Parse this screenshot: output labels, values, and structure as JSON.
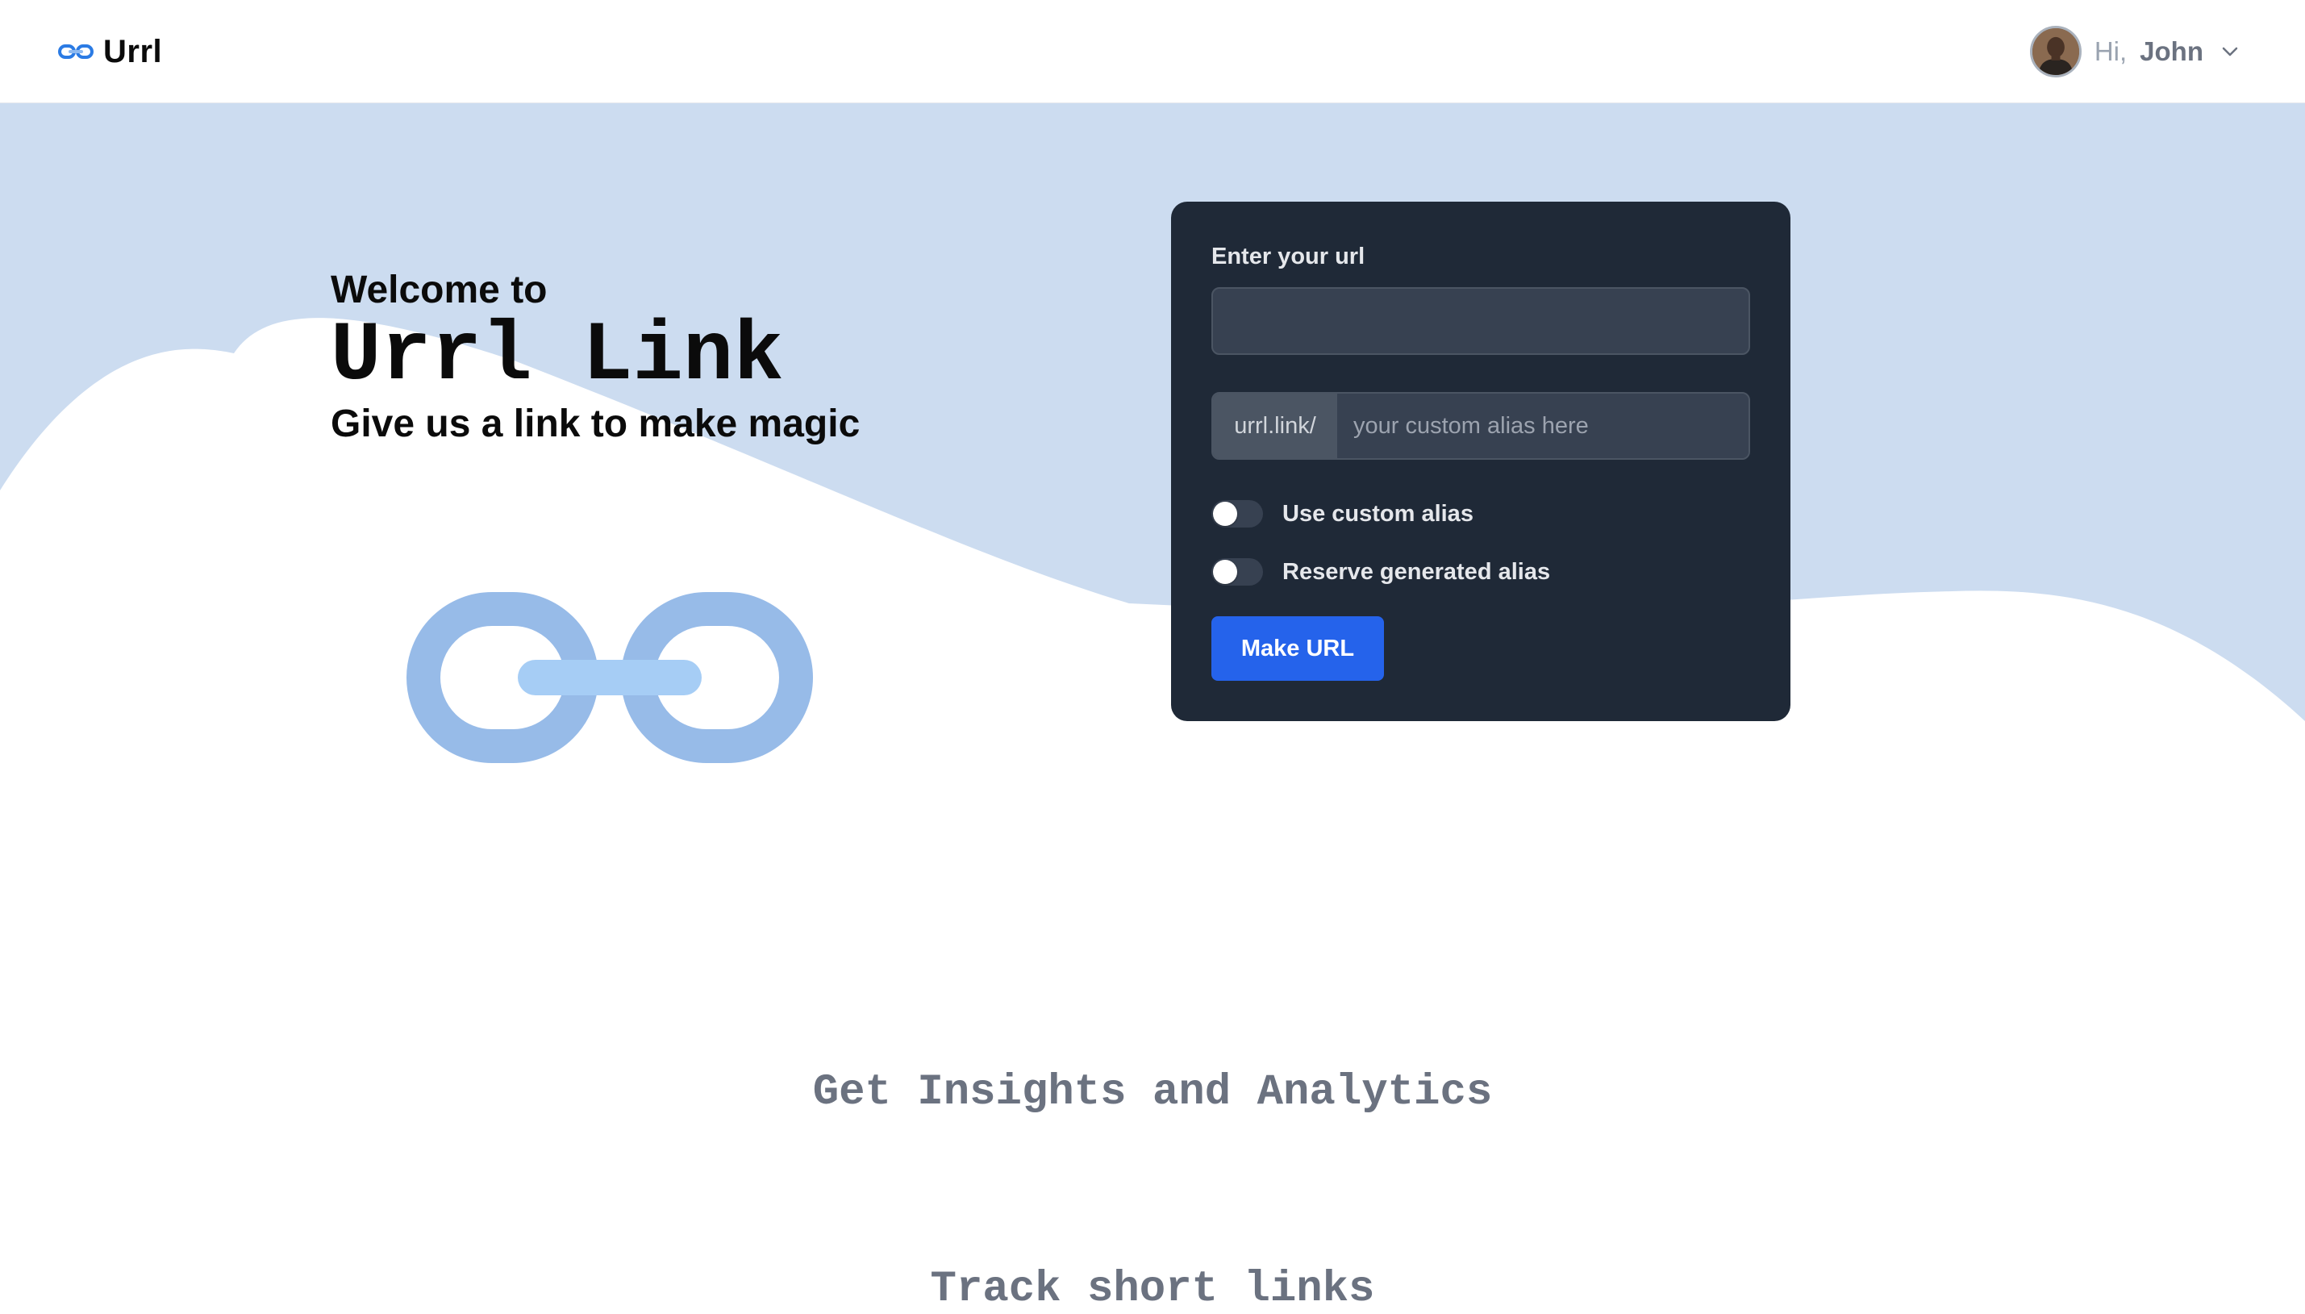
{
  "header": {
    "logo_text": "Urrl",
    "logo_icon": "link-icon",
    "greeting": "Hi,",
    "user_name": "John",
    "avatar": "user-avatar",
    "menu_icon": "chevron-down-icon"
  },
  "hero": {
    "welcome": "Welcome to",
    "brand": "Urrl Link",
    "tagline": "Give us a link to make magic",
    "illustration": "chain-link-icon",
    "background_color": "#CCDDF0"
  },
  "form": {
    "url_label": "Enter your url",
    "url_value": "",
    "alias_prefix": "urrl.link/",
    "alias_placeholder": "your custom alias here",
    "alias_value": "",
    "toggles": [
      {
        "label": "Use custom alias",
        "on": false
      },
      {
        "label": "Reserve generated alias",
        "on": false
      }
    ],
    "submit_label": "Make URL",
    "accent_color": "#2563EB",
    "card_color": "#1F2937"
  },
  "insights": {
    "title": "Get Insights and Analytics",
    "subtitle": "Track short links"
  }
}
